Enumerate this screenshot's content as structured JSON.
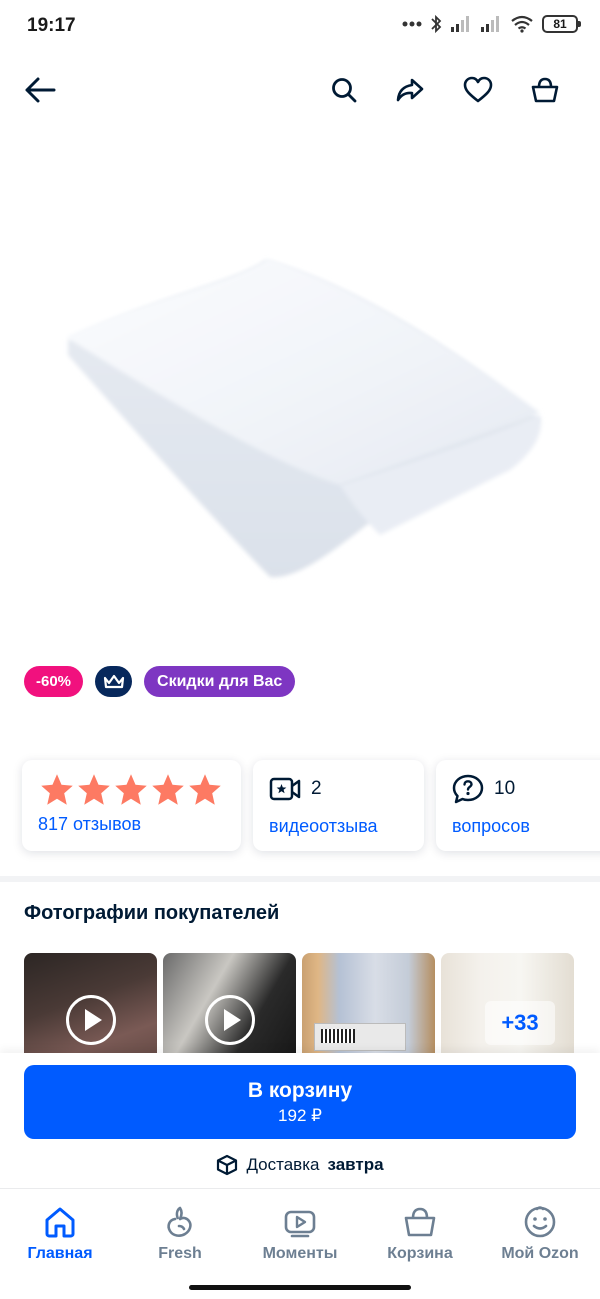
{
  "status_bar": {
    "time": "19:17",
    "battery": "81",
    "icons": [
      "dots-icon",
      "bluetooth-icon",
      "signal-icon",
      "signal-icon",
      "wifi-icon",
      "battery-icon"
    ]
  },
  "topnav": {
    "icons": [
      "back-arrow-icon",
      "search-icon",
      "share-icon",
      "heart-icon",
      "cart-icon"
    ]
  },
  "product": {
    "image": "white-foam-pad"
  },
  "badges": {
    "discount": "-60%",
    "premium_icon": "crown-icon",
    "promo": "Скидки для Вас"
  },
  "colors": {
    "accent": "#005bff",
    "discount": "#f1117e",
    "promo": "#7e36c2",
    "crown_bg": "#07285c",
    "star": "#fd7a63"
  },
  "stats": {
    "rating_stars": 5,
    "reviews_link": "817 отзывов",
    "video_count": "2",
    "video_link": "видеоотзыва",
    "questions_count": "10",
    "questions_link": "вопросов"
  },
  "customer_photos": {
    "title": "Фотографии покупателей",
    "more": "+33"
  },
  "cart": {
    "label": "В корзину",
    "price": "192 ₽"
  },
  "delivery": {
    "prefix": "Доставка",
    "when": "завтра"
  },
  "tabbar": {
    "items": [
      {
        "label": "Главная",
        "icon": "home-icon",
        "active": true
      },
      {
        "label": "Fresh",
        "icon": "fresh-icon",
        "active": false
      },
      {
        "label": "Моменты",
        "icon": "moments-icon",
        "active": false
      },
      {
        "label": "Корзина",
        "icon": "basket-icon",
        "active": false
      },
      {
        "label": "Мой Ozon",
        "icon": "profile-icon",
        "active": false
      }
    ]
  }
}
